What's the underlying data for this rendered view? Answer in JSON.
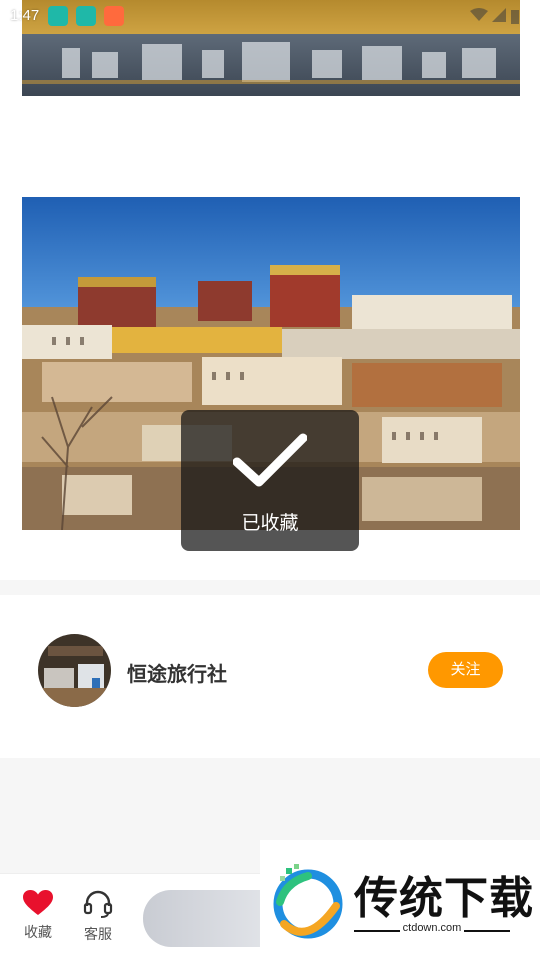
{
  "status_bar": {
    "time": "1:47"
  },
  "toast": {
    "icon": "checkmark-icon",
    "text": "已收藏"
  },
  "agency": {
    "name": "恒途旅行社",
    "follow_label": "关注"
  },
  "bottom_bar": {
    "favorite_label": "收藏",
    "favorite_icon": "heart-icon",
    "service_label": "客服",
    "service_icon": "headset-icon"
  },
  "watermark": {
    "title": "传统下载",
    "url": "ctdown.com"
  },
  "colors": {
    "accent": "#ff9800",
    "favorite": "#e8112d",
    "toast_bg": "#141414"
  }
}
